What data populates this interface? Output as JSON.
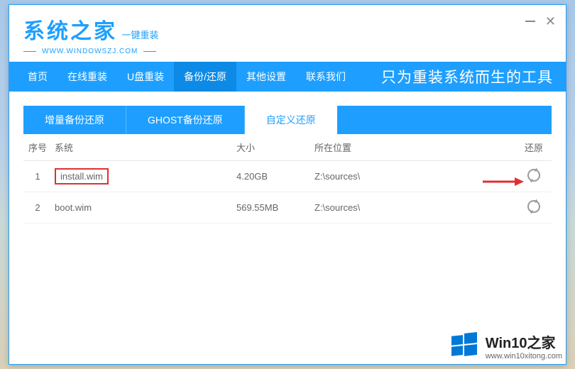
{
  "title": {
    "main": "系统之家",
    "sub": "一键重装",
    "url": "WWW.WINDOWSZJ.COM"
  },
  "nav": {
    "items": [
      "首页",
      "在线重装",
      "U盘重装",
      "备份/还原",
      "其他设置",
      "联系我们"
    ],
    "active_index": 3,
    "tagline": "只为重装系统而生的工具"
  },
  "subtabs": {
    "items": [
      "增量备份还原",
      "GHOST备份还原",
      "自定义还原"
    ],
    "active_index": 2
  },
  "table": {
    "headers": {
      "index": "序号",
      "system": "系统",
      "size": "大小",
      "location": "所在位置",
      "action": "还原"
    },
    "rows": [
      {
        "index": "1",
        "system": "install.wim",
        "size": "4.20GB",
        "location": "Z:\\sources\\",
        "highlighted": true
      },
      {
        "index": "2",
        "system": "boot.wim",
        "size": "569.55MB",
        "location": "Z:\\sources\\",
        "highlighted": false
      }
    ]
  },
  "watermark": {
    "main": "Win10之家",
    "sub": "www.win10xitong.com"
  }
}
